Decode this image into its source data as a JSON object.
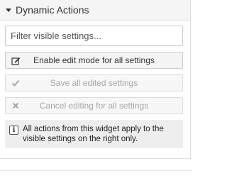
{
  "widget": {
    "title": "Dynamic Actions",
    "toggle_icon": "caret-down-icon",
    "filter": {
      "placeholder": "Filter visible settings...",
      "value": ""
    },
    "actions": [
      {
        "label": "Enable edit mode for all settings",
        "icon": "edit-icon",
        "enabled": true
      },
      {
        "label": "Save all edited settings",
        "icon": "check-icon",
        "enabled": false
      },
      {
        "label": "Cancel editing for all settings",
        "icon": "close-icon",
        "enabled": false
      }
    ],
    "info": {
      "icon": "info-icon",
      "text": "All actions from this widget apply to the visible settings on the right only."
    }
  },
  "colors": {
    "text": "#333333",
    "disabled_text": "#a6a6a6",
    "header_bg": "#f5f5f5",
    "button_bg": "#f4f4f4",
    "info_bg": "#eeeeee",
    "border": "#cccccc"
  }
}
